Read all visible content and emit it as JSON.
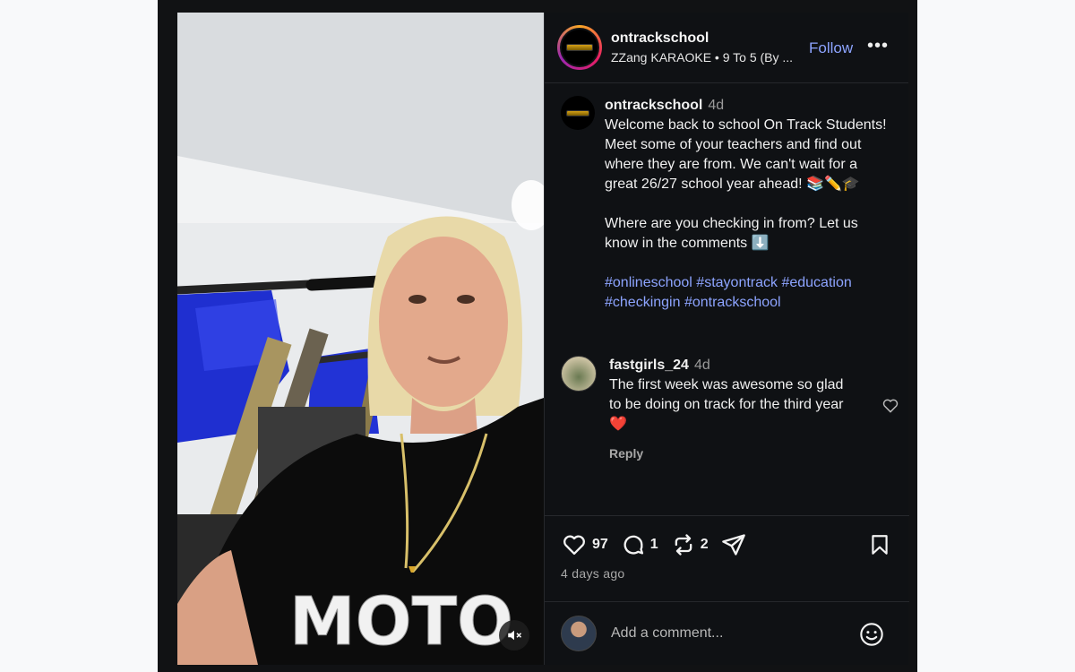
{
  "post": {
    "header": {
      "username": "ontrackschool",
      "audio": "ZZang KARAOKE • 9 To 5 (By ...",
      "follow_label": "Follow",
      "more_label": "•••"
    },
    "caption": {
      "username": "ontrackschool",
      "time": "4d",
      "line1": "Welcome back to school On Track Students! Meet some of your teachers and find out where they are from. We can't wait for a great 26/27 school year ahead! 📚✏️🎓",
      "line2": "Where are you checking in from? Let us know in the comments ⬇️",
      "hashtags": "#onlineschool #stayontrack #education #checkingin #ontrackschool"
    },
    "comment": {
      "username": "fastgirls_24",
      "time": "4d",
      "text": "The first week was awesome so glad to be doing on track for the third year❤️",
      "reply_label": "Reply"
    },
    "actions": {
      "likes": "97",
      "comments": "1",
      "reposts": "2",
      "posted_ago": "4 days ago"
    },
    "add_comment": {
      "placeholder": "Add a comment..."
    },
    "media": {
      "shirt_text": "MOTO"
    }
  },
  "colors": {
    "accent_link": "#8da4ff",
    "panel_bg": "#0f1114",
    "bike_blue": "#1f2fd0"
  }
}
